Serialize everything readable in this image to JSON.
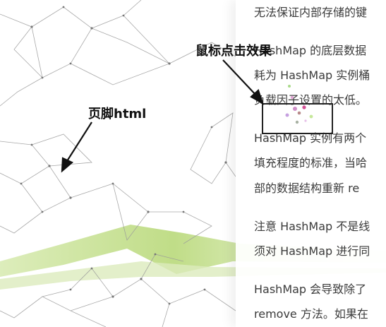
{
  "article": {
    "lines": [
      "无法保证内部存储的键",
      "HashMap 的底层数据",
      "耗为 HashMap 实例桶",
      "负载因子设置的太低。",
      "HashMap 实例有两个",
      "填充程度的标准，当哈",
      "部的数据结构重新 re",
      "注意 HashMap 不是线",
      "须对 HashMap 进行同",
      "HashMap 会导致除了",
      "remove 方法。如果在"
    ]
  },
  "annotations": {
    "mouse_click": "鼠标点击效果",
    "footer": "页脚html"
  },
  "colors": {
    "text": "#3b3b3b",
    "network_line": "#8f8f8f",
    "green_band": "#c6df8f",
    "annotation": "#111111"
  }
}
